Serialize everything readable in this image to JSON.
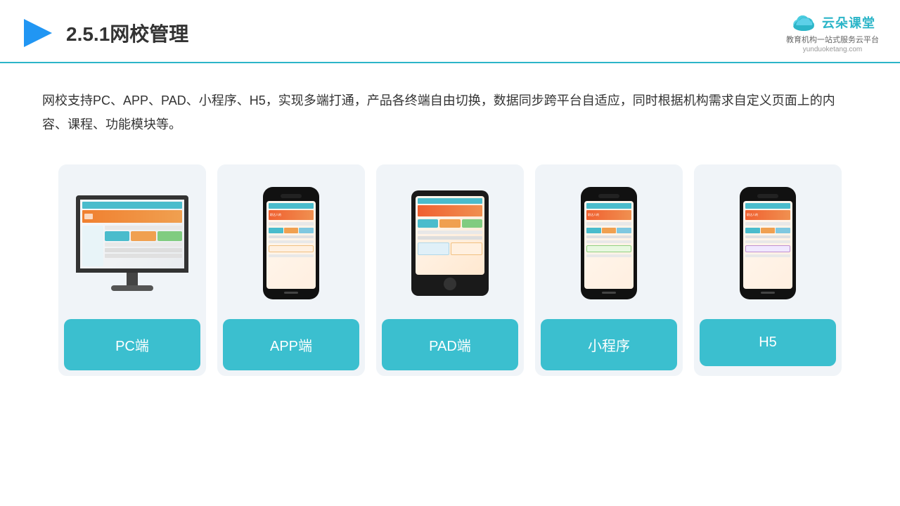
{
  "header": {
    "section_number": "2.5.1",
    "title": "网校管理",
    "logo_main": "云朵课堂",
    "logo_url": "yunduoketang.com",
    "logo_subtitle": "教育机构一站\n式服务云平台"
  },
  "description": {
    "text": "网校支持PC、APP、PAD、小程序、H5，实现多端打通，产品各终端自由切换，数据同步跨平台自适应，同时根据机构需求自定义页面上的内容、课程、功能模块等。"
  },
  "cards": [
    {
      "id": "pc",
      "label": "PC端"
    },
    {
      "id": "app",
      "label": "APP端"
    },
    {
      "id": "pad",
      "label": "PAD端"
    },
    {
      "id": "miniprogram",
      "label": "小程序"
    },
    {
      "id": "h5",
      "label": "H5"
    }
  ],
  "colors": {
    "teal": "#3bbfcf",
    "title_line": "#2cb5c8",
    "text_dark": "#333333"
  }
}
